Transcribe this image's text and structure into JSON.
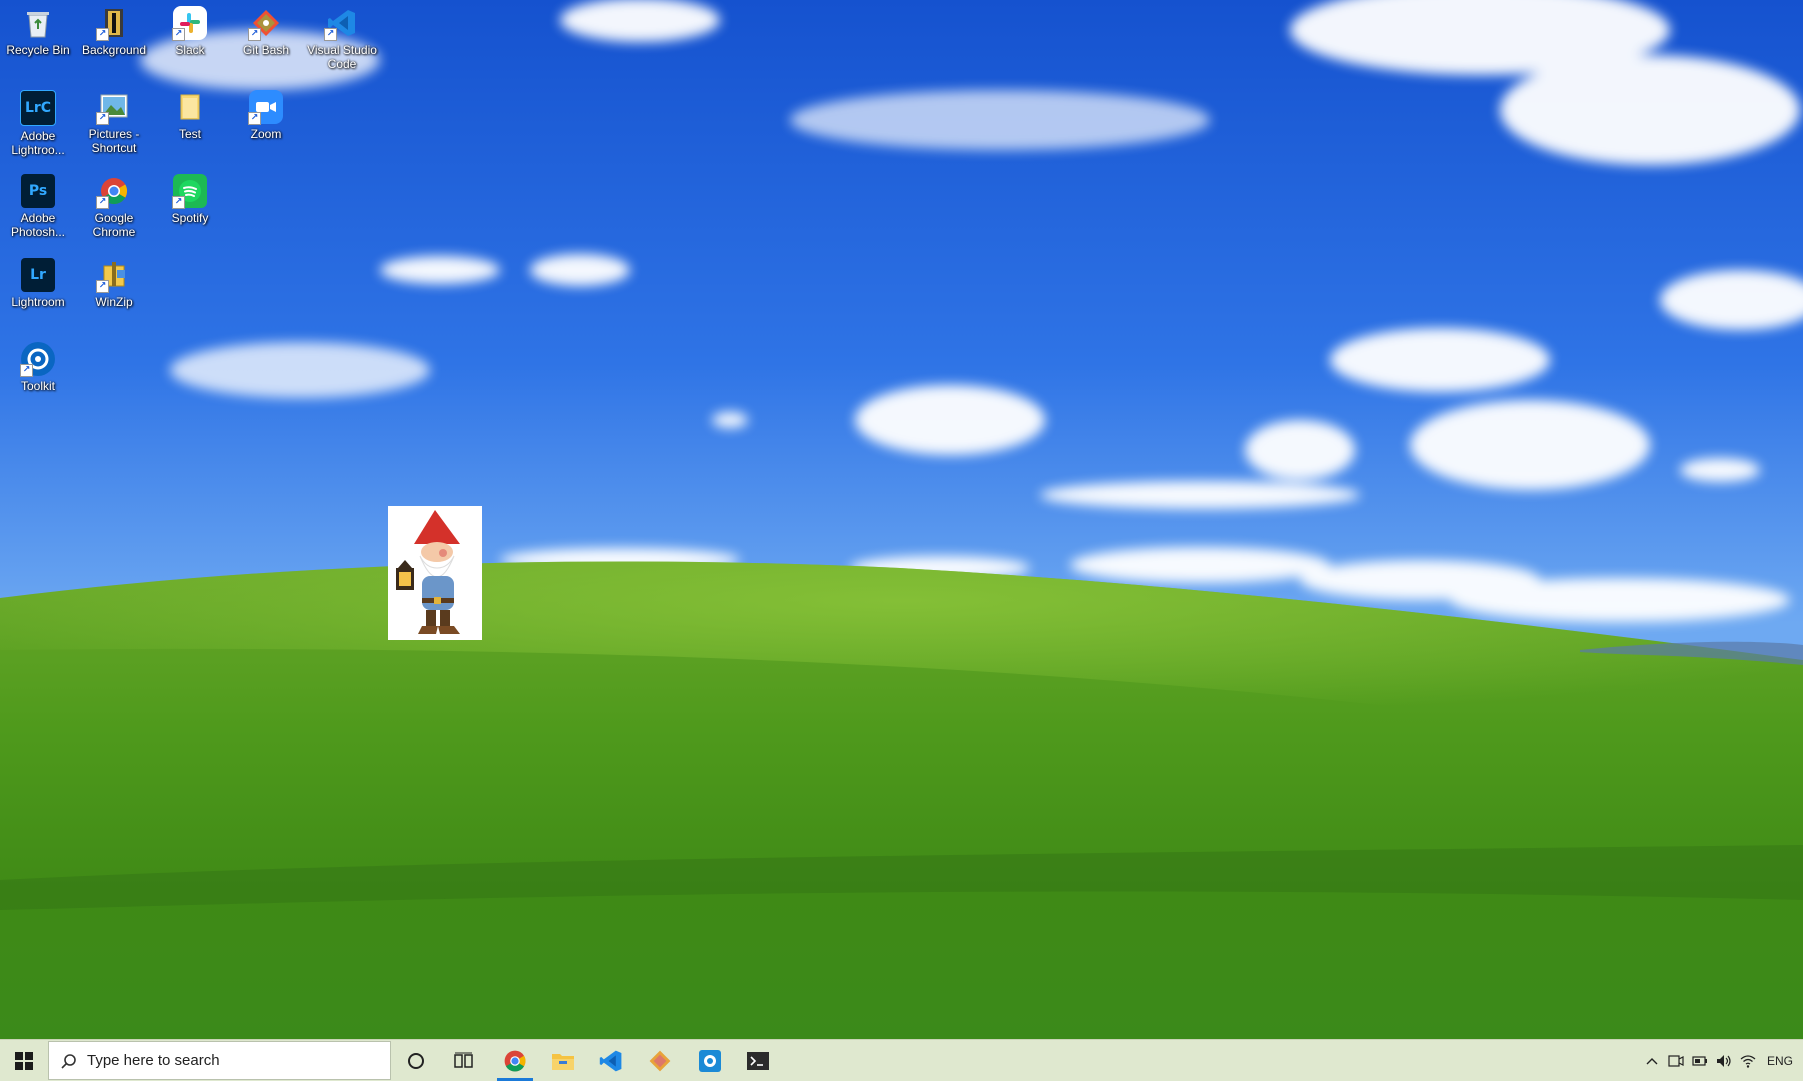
{
  "desktop": {
    "icons": [
      {
        "label": "Recycle Bin",
        "icon": "recycle-bin-icon"
      },
      {
        "label": "Background",
        "icon": "background-icon"
      },
      {
        "label": "Slack",
        "icon": "slack-icon"
      },
      {
        "label": "Git Bash",
        "icon": "git-bash-icon"
      },
      {
        "label": "Visual Studio Code",
        "icon": "vscode-icon"
      },
      {
        "label": "Adobe Lightroo...",
        "icon": "lightroom-classic-icon",
        "glyph": "LrC"
      },
      {
        "label": "Pictures - Shortcut",
        "icon": "pictures-shortcut-icon"
      },
      {
        "label": "Test",
        "icon": "folder-icon"
      },
      {
        "label": "Zoom",
        "icon": "zoom-icon"
      },
      {
        "label": "Adobe Photosh...",
        "icon": "photoshop-icon",
        "glyph": "Ps"
      },
      {
        "label": "Google Chrome",
        "icon": "chrome-icon"
      },
      {
        "label": "Spotify",
        "icon": "spotify-icon"
      },
      {
        "label": "Lightroom",
        "icon": "lightroom-icon",
        "glyph": "Lr"
      },
      {
        "label": "WinZip",
        "icon": "winzip-icon"
      },
      {
        "label": "Toolkit",
        "icon": "toolkit-icon"
      }
    ]
  },
  "taskbar": {
    "search_placeholder": "Type here to search",
    "pinned": [
      {
        "icon": "chrome-icon",
        "active": true
      },
      {
        "icon": "file-explorer-icon"
      },
      {
        "icon": "vscode-icon"
      },
      {
        "icon": "git-icon"
      },
      {
        "icon": "snipping-icon"
      },
      {
        "icon": "terminal-icon"
      }
    ],
    "tray": {
      "language": "ENG"
    }
  },
  "colors": {
    "taskbar_bg": "#dfe8cf",
    "accent": "#1b7ad8",
    "sky": "#2a6fe6",
    "grass": "#4f9a1c"
  }
}
